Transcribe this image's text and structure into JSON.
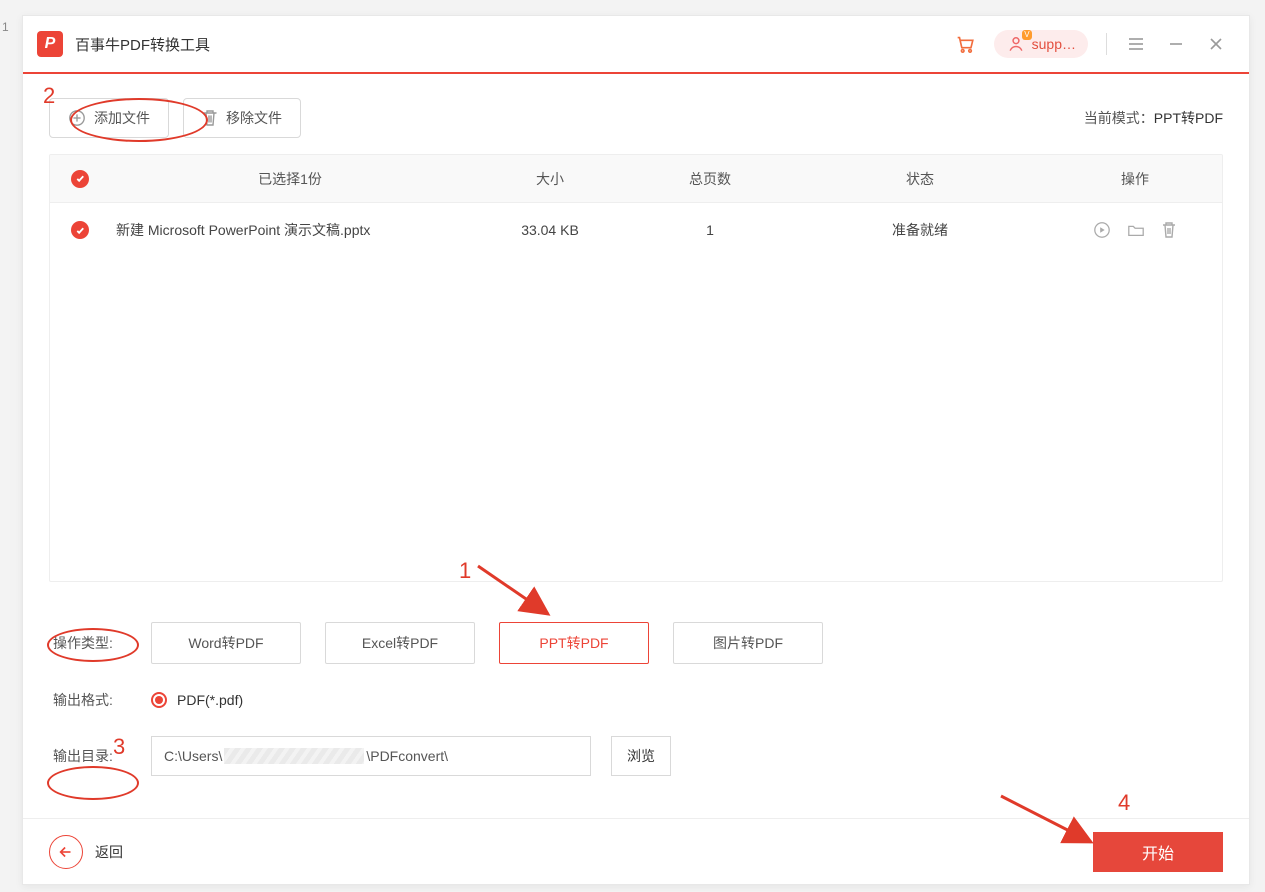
{
  "app": {
    "title": "百事牛PDF转换工具",
    "logo_letter": "P"
  },
  "titlebar": {
    "user_label": "supp…"
  },
  "toolbar": {
    "add_label": "添加文件",
    "remove_label": "移除文件",
    "mode_prefix": "当前模式：",
    "mode_value": "PPT转PDF"
  },
  "table": {
    "header": {
      "selected": "已选择1份",
      "size": "大小",
      "pages": "总页数",
      "status": "状态",
      "ops": "操作"
    },
    "rows": [
      {
        "name": "新建 Microsoft PowerPoint 演示文稿.pptx",
        "size": "33.04 KB",
        "pages": "1",
        "status": "准备就绪"
      }
    ]
  },
  "options": {
    "type_label": "操作类型:",
    "types": [
      "Word转PDF",
      "Excel转PDF",
      "PPT转PDF",
      "图片转PDF"
    ],
    "active_type_index": 2,
    "format_label": "输出格式:",
    "format_value": "PDF(*.pdf)",
    "dir_label": "输出目录:",
    "dir_prefix": "C:\\Users\\",
    "dir_suffix": "\\PDFconvert\\",
    "browse_label": "浏览"
  },
  "footer": {
    "back_label": "返回",
    "start_label": "开始"
  },
  "annotations": {
    "n1": "1",
    "n2": "2",
    "n3": "3",
    "n4": "4"
  },
  "outside": {
    "left_digit": "1"
  }
}
